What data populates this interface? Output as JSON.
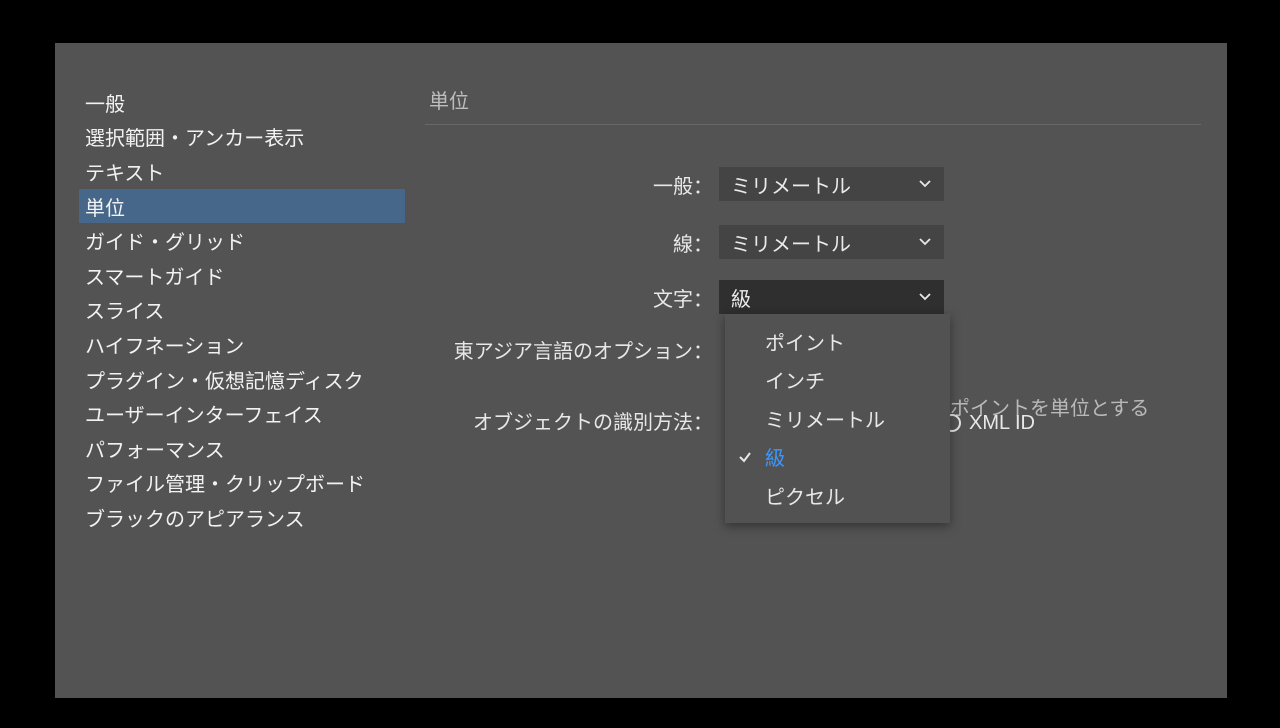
{
  "sidebar": {
    "items": [
      {
        "label": "一般",
        "selected": false
      },
      {
        "label": "選択範囲・アンカー表示",
        "selected": false
      },
      {
        "label": "テキスト",
        "selected": false
      },
      {
        "label": "単位",
        "selected": true
      },
      {
        "label": "ガイド・グリッド",
        "selected": false
      },
      {
        "label": "スマートガイド",
        "selected": false
      },
      {
        "label": "スライス",
        "selected": false
      },
      {
        "label": "ハイフネーション",
        "selected": false
      },
      {
        "label": "プラグイン・仮想記憶ディスク",
        "selected": false
      },
      {
        "label": "ユーザーインターフェイス",
        "selected": false
      },
      {
        "label": "パフォーマンス",
        "selected": false
      },
      {
        "label": "ファイル管理・クリップボード",
        "selected": false
      },
      {
        "label": "ブラックのアピアランス",
        "selected": false
      }
    ]
  },
  "content": {
    "title": "単位",
    "rows": {
      "general": {
        "label": "一般：",
        "value": "ミリメートル"
      },
      "line": {
        "label": "線：",
        "value": "ミリメートル"
      },
      "text": {
        "label": "文字：",
        "value": "級"
      },
      "east_asian": {
        "label": "東アジア言語のオプション："
      },
      "object_id": {
        "label": "オブジェクトの識別方法："
      }
    },
    "dropdown": {
      "options": [
        {
          "label": "ポイント",
          "selected": false
        },
        {
          "label": "インチ",
          "selected": false
        },
        {
          "label": "ミリメートル",
          "selected": false
        },
        {
          "label": "級",
          "selected": true
        },
        {
          "label": "ピクセル",
          "selected": false
        }
      ]
    },
    "partial": {
      "note_suffix": "ポイントを単位とする",
      "radio_label": "XML ID"
    }
  }
}
